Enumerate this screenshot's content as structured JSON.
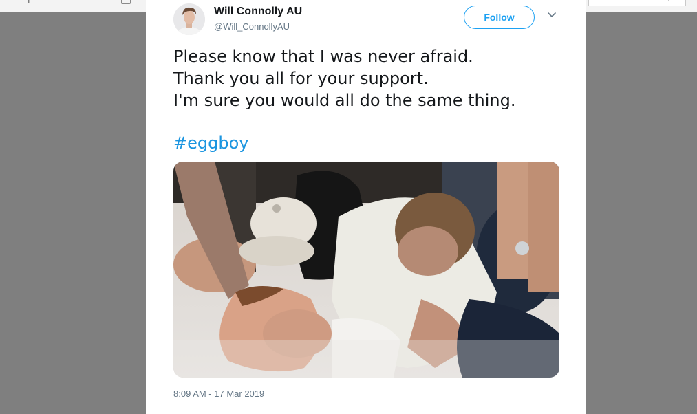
{
  "tweet": {
    "display_name": "Will Connolly AU",
    "handle": "@Will_ConnollyAU",
    "follow_label": "Follow",
    "lines": [
      "Please know that I was never afraid.",
      "Thank you all for your support.",
      "I'm sure you would all do the same thing."
    ],
    "hashtag": "#eggboy",
    "timestamp": "8:09 AM - 17 Mar 2019"
  },
  "colors": {
    "accent": "#1da1f2",
    "hashtag": "#1b95e0",
    "text": "#14171a",
    "muted": "#657786",
    "backdrop": "#7f7f7f"
  },
  "icons": {
    "more_menu": "chevron-down-icon",
    "avatar": "avatar-photo"
  }
}
